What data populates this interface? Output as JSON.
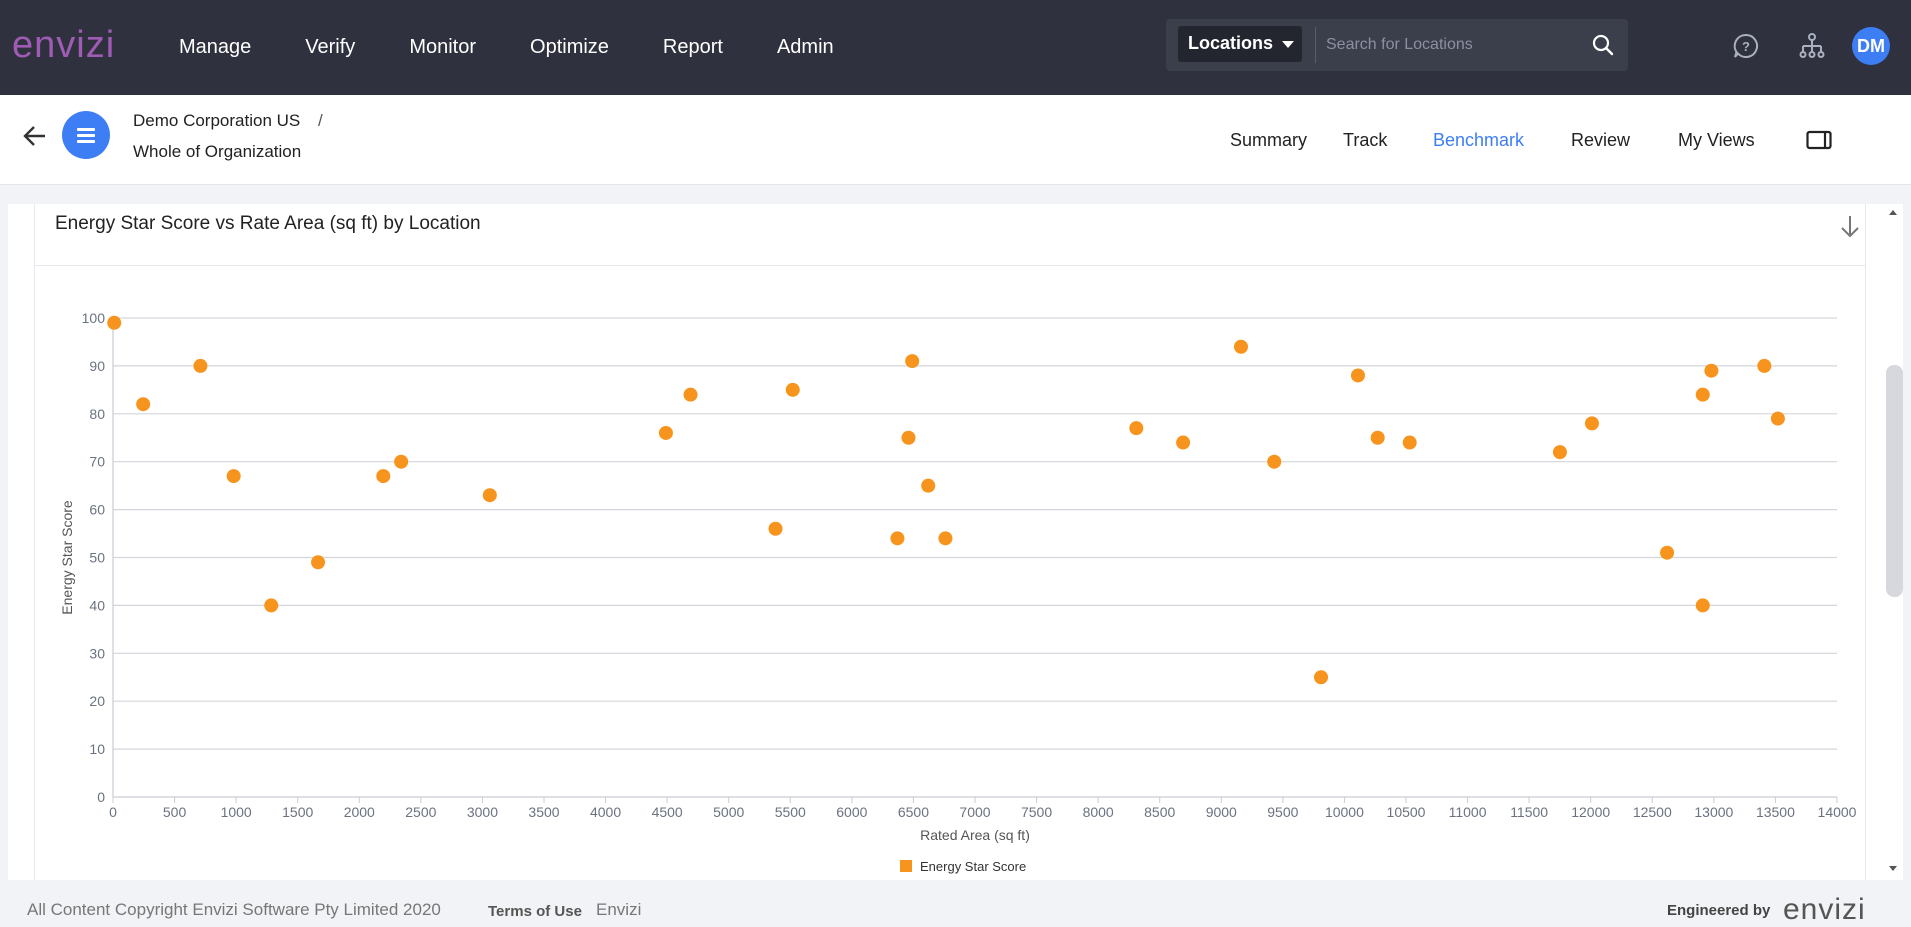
{
  "app": {
    "logo": "envizi",
    "brand_color": "#a05bb4",
    "accent": "#3d7ef5"
  },
  "nav": {
    "items": [
      "Manage",
      "Verify",
      "Monitor",
      "Optimize",
      "Report",
      "Admin"
    ]
  },
  "search": {
    "scope": "Locations",
    "placeholder": "Search for Locations"
  },
  "user": {
    "initials": "DM"
  },
  "breadcrumb": {
    "org": "Demo Corporation US",
    "separator": "/",
    "scope": "Whole of Organization"
  },
  "tabs": [
    {
      "label": "Summary",
      "active": false
    },
    {
      "label": "Track",
      "active": false
    },
    {
      "label": "Benchmark",
      "active": true
    },
    {
      "label": "Review",
      "active": false
    },
    {
      "label": "My Views",
      "active": false
    }
  ],
  "card": {
    "title": "Energy Star Score vs Rate Area (sq ft) by Location"
  },
  "chart_data": {
    "type": "scatter",
    "title": "Energy Star Score vs Rate Area (sq ft) by Location",
    "xlabel": "Rated Area (sq ft)",
    "ylabel": "Energy Star Score",
    "xlim": [
      0,
      14000
    ],
    "ylim": [
      0,
      100
    ],
    "x_ticks": [
      0,
      500,
      1000,
      1500,
      2000,
      2500,
      3000,
      3500,
      4000,
      4500,
      5000,
      5500,
      6000,
      6500,
      7000,
      7500,
      8000,
      8500,
      9000,
      9500,
      10000,
      10500,
      11000,
      11500,
      12000,
      12500,
      13000,
      13500,
      14000
    ],
    "y_ticks": [
      0,
      10,
      20,
      30,
      40,
      50,
      60,
      70,
      80,
      90,
      100
    ],
    "grid": true,
    "legend_position": "bottom-center",
    "series": [
      {
        "name": "Energy Star Score",
        "color": "#f7941d",
        "points": [
          [
            10,
            99
          ],
          [
            245,
            82
          ],
          [
            710,
            90
          ],
          [
            980,
            67
          ],
          [
            1285,
            40
          ],
          [
            1665,
            49
          ],
          [
            2195,
            67
          ],
          [
            2340,
            70
          ],
          [
            3060,
            63
          ],
          [
            4490,
            76
          ],
          [
            4690,
            84
          ],
          [
            5380,
            56
          ],
          [
            5520,
            85
          ],
          [
            6370,
            54
          ],
          [
            6460,
            75
          ],
          [
            6490,
            91
          ],
          [
            6620,
            65
          ],
          [
            6760,
            54
          ],
          [
            8310,
            77
          ],
          [
            8690,
            74
          ],
          [
            9160,
            94
          ],
          [
            9430,
            70
          ],
          [
            9810,
            25
          ],
          [
            10110,
            88
          ],
          [
            10270,
            75
          ],
          [
            10530,
            74
          ],
          [
            11750,
            72
          ],
          [
            12010,
            78
          ],
          [
            12620,
            51
          ],
          [
            12910,
            84
          ],
          [
            12910,
            40
          ],
          [
            12980,
            89
          ],
          [
            13410,
            90
          ],
          [
            13520,
            79
          ]
        ]
      }
    ]
  },
  "footer": {
    "copyright": "All Content Copyright Envizi Software Pty Limited 2020",
    "terms": "Terms of Use",
    "link": "Envizi",
    "engineered_by": "Engineered by",
    "logo": "envizi"
  }
}
